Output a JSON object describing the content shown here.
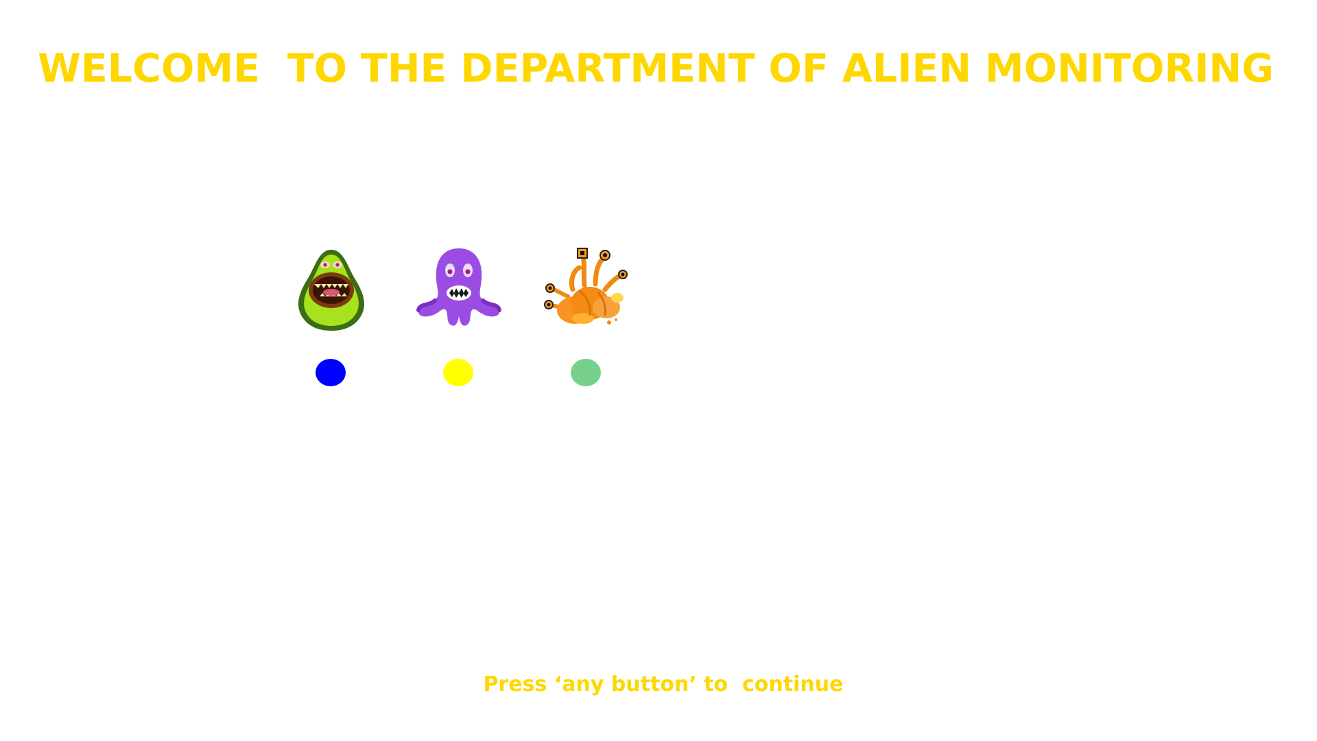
{
  "screen": {
    "title": "WELCOME  TO THE DEPARTMENT OF ALIEN MONITORING",
    "prompt": "Press ‘any button’ to  continue",
    "title_color": "#FFD700"
  },
  "aliens": [
    {
      "icon": "avocado-alien-icon",
      "indicator_color": "#0000FF"
    },
    {
      "icon": "purple-octopus-alien-icon",
      "indicator_color": "#FFFF00"
    },
    {
      "icon": "orange-croissant-alien-icon",
      "indicator_color": "#77D18A"
    }
  ]
}
